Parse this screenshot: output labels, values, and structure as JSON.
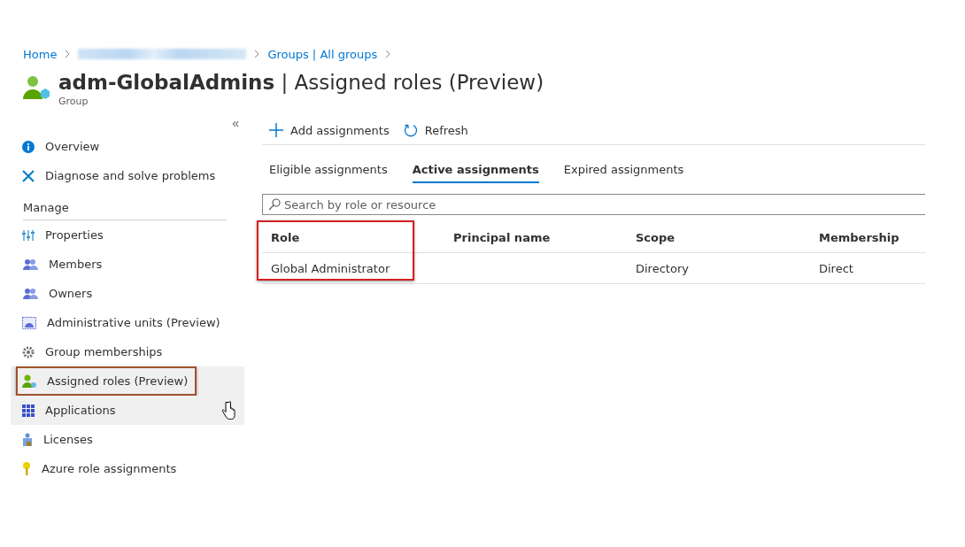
{
  "breadcrumb": [
    {
      "label": "Home",
      "redacted": false
    },
    {
      "redacted": true
    },
    {
      "label": "Groups | All groups",
      "redacted": false
    }
  ],
  "header": {
    "name": "adm-GlobalAdmins",
    "separator": "|",
    "title": "Assigned roles (Preview)",
    "subtitle": "Group"
  },
  "sidebar": {
    "collapse": "«",
    "items": [
      {
        "kind": "item",
        "label": "Overview",
        "selected": false,
        "hovered": false,
        "annotated": false
      },
      {
        "kind": "item",
        "label": "Diagnose and solve problems",
        "selected": false,
        "hovered": false,
        "annotated": false
      },
      {
        "kind": "section",
        "label": "Manage"
      },
      {
        "kind": "item",
        "label": "Properties",
        "selected": false,
        "hovered": false,
        "annotated": false
      },
      {
        "kind": "item",
        "label": "Members",
        "selected": false,
        "hovered": false,
        "annotated": false
      },
      {
        "kind": "item",
        "label": "Owners",
        "selected": false,
        "hovered": false,
        "annotated": false
      },
      {
        "kind": "item",
        "label": "Administrative units (Preview)",
        "selected": false,
        "hovered": false,
        "annotated": false
      },
      {
        "kind": "item",
        "label": "Group memberships",
        "selected": false,
        "hovered": false,
        "annotated": false
      },
      {
        "kind": "item",
        "label": "Assigned roles (Preview)",
        "selected": true,
        "hovered": false,
        "annotated": true
      },
      {
        "kind": "item",
        "label": "Applications",
        "selected": false,
        "hovered": true,
        "annotated": false
      },
      {
        "kind": "item",
        "label": "Licenses",
        "selected": false,
        "hovered": false,
        "annotated": false
      },
      {
        "kind": "item",
        "label": "Azure role assignments",
        "selected": false,
        "hovered": false,
        "annotated": false
      }
    ]
  },
  "toolbar": [
    {
      "kind": "add",
      "label": "Add assignments"
    },
    {
      "kind": "refresh",
      "label": "Refresh"
    }
  ],
  "tabs": [
    {
      "label": "Eligible assignments",
      "selected": false
    },
    {
      "label": "Active assignments",
      "selected": true
    },
    {
      "label": "Expired assignments",
      "selected": false
    }
  ],
  "search": {
    "placeholder": "Search by role or resource"
  },
  "table": {
    "columns": [
      {
        "label": "Role",
        "annotated": true
      },
      {
        "label": "Principal name",
        "annotated": false
      },
      {
        "label": "Scope",
        "annotated": false
      },
      {
        "label": "Membership",
        "annotated": false
      }
    ],
    "rows": [
      [
        "Global Administrator",
        "",
        "Directory",
        "Direct"
      ]
    ]
  }
}
